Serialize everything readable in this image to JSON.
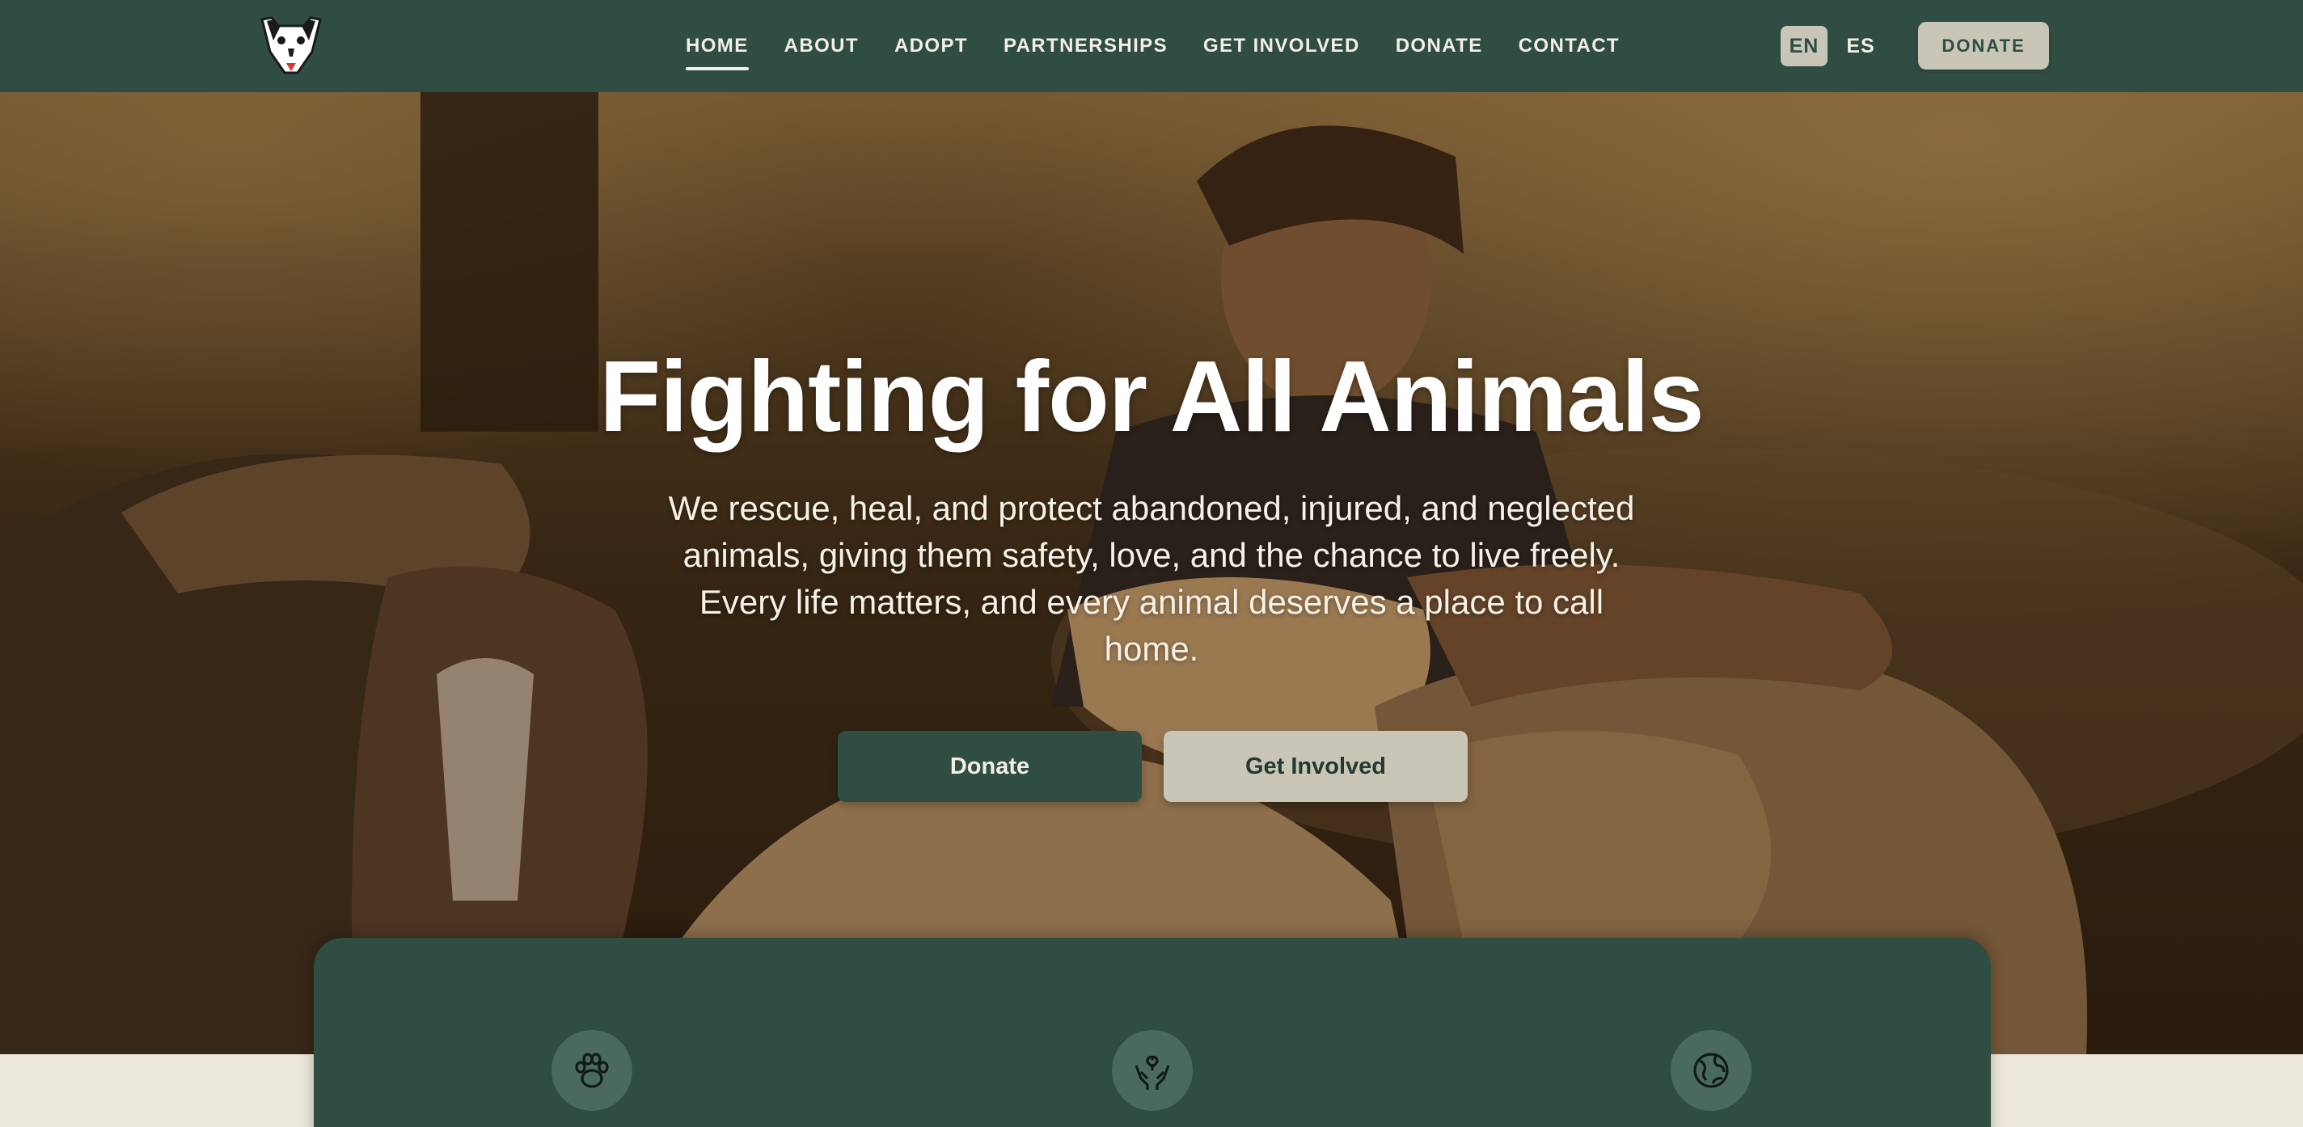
{
  "header": {
    "logo_name": "dog-face-logo",
    "nav": [
      {
        "label": "HOME",
        "active": true
      },
      {
        "label": "ABOUT",
        "active": false
      },
      {
        "label": "ADOPT",
        "active": false
      },
      {
        "label": "PARTNERSHIPS",
        "active": false
      },
      {
        "label": "GET INVOLVED",
        "active": false
      },
      {
        "label": "DONATE",
        "active": false
      },
      {
        "label": "CONTACT",
        "active": false
      }
    ],
    "languages": {
      "en": "EN",
      "es": "ES",
      "selected": "EN"
    },
    "donate_label": "DONATE"
  },
  "hero": {
    "title": "Fighting for All Animals",
    "text": "We rescue, heal, and protect abandoned, injured, and neglected animals, giving them safety, love, and the chance to live freely. Every life matters, and every animal deserves a place to call home.",
    "primary_button": "Donate",
    "secondary_button": "Get Involved"
  },
  "features": {
    "icons": [
      "paw-icon",
      "heart-hands-icon",
      "globe-icon"
    ]
  },
  "colors": {
    "brand_green": "#2f4d43",
    "accent_beige": "#c9c6b8",
    "background_cream": "#ece7dc"
  }
}
